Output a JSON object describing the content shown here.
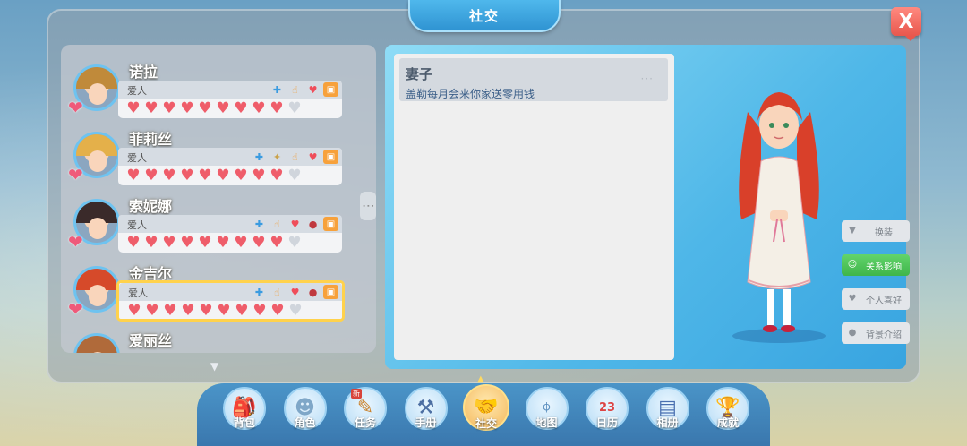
{
  "window": {
    "title": "社交",
    "close_label": "X"
  },
  "friends": [
    {
      "name": "诺拉",
      "relation": "爱人",
      "hearts_filled": 9,
      "hearts_total": 10,
      "tags": [
        "blue-arrow-icon",
        "finger-icon",
        "heart-icon",
        "gift-icon"
      ],
      "hair_color": "#c08a3a"
    },
    {
      "name": "菲莉丝",
      "relation": "爱人",
      "hearts_filled": 9,
      "hearts_total": 10,
      "tags": [
        "blue-arrow-icon",
        "star-icon",
        "finger-icon",
        "heart-icon",
        "gift-icon"
      ],
      "hair_color": "#e4b04a"
    },
    {
      "name": "索妮娜",
      "relation": "爱人",
      "hearts_filled": 9,
      "hearts_total": 10,
      "tags": [
        "blue-arrow-icon",
        "finger-icon",
        "heart-icon",
        "rose-icon",
        "gift-icon"
      ],
      "hair_color": "#3a2a2a"
    },
    {
      "name": "金吉尔",
      "relation": "爱人",
      "hearts_filled": 9,
      "hearts_total": 10,
      "tags": [
        "blue-arrow-icon",
        "finger-icon",
        "heart-icon",
        "rose-icon",
        "gift-icon"
      ],
      "hair_color": "#d64a2a",
      "selected": true
    },
    {
      "name": "爱丽丝",
      "relation": "",
      "hearts_filled": 0,
      "hearts_total": 0,
      "tags": [],
      "hair_color": "#b06a3a"
    }
  ],
  "detail": {
    "title": "妻子",
    "description": "盖勒每月会来你家送零用钱",
    "more": "···"
  },
  "side_buttons": [
    {
      "label": "换装",
      "icon": "shirt-icon",
      "active": false
    },
    {
      "label": "关系影响",
      "icon": "smile-icon",
      "active": true
    },
    {
      "label": "个人喜好",
      "icon": "heart-icon",
      "active": false
    },
    {
      "label": "背景介绍",
      "icon": "person-icon",
      "active": false
    }
  ],
  "nav": [
    {
      "label": "背包",
      "icon": "backpack-icon"
    },
    {
      "label": "角色",
      "icon": "character-icon"
    },
    {
      "label": "任务",
      "icon": "quest-icon",
      "badge": "新"
    },
    {
      "label": "手册",
      "icon": "hammer-icon"
    },
    {
      "label": "社交",
      "icon": "handshake-icon",
      "active": true
    },
    {
      "label": "地图",
      "icon": "map-icon"
    },
    {
      "label": "日历",
      "icon": "calendar-icon",
      "calendar_day": "23"
    },
    {
      "label": "相册",
      "icon": "album-icon"
    },
    {
      "label": "成就",
      "icon": "trophy-icon"
    }
  ],
  "colors": {
    "accent_blue": "#3f9ee0",
    "heart_red": "#ef5d6a",
    "selected_gold": "#ffd24c",
    "active_green": "#45b950"
  }
}
